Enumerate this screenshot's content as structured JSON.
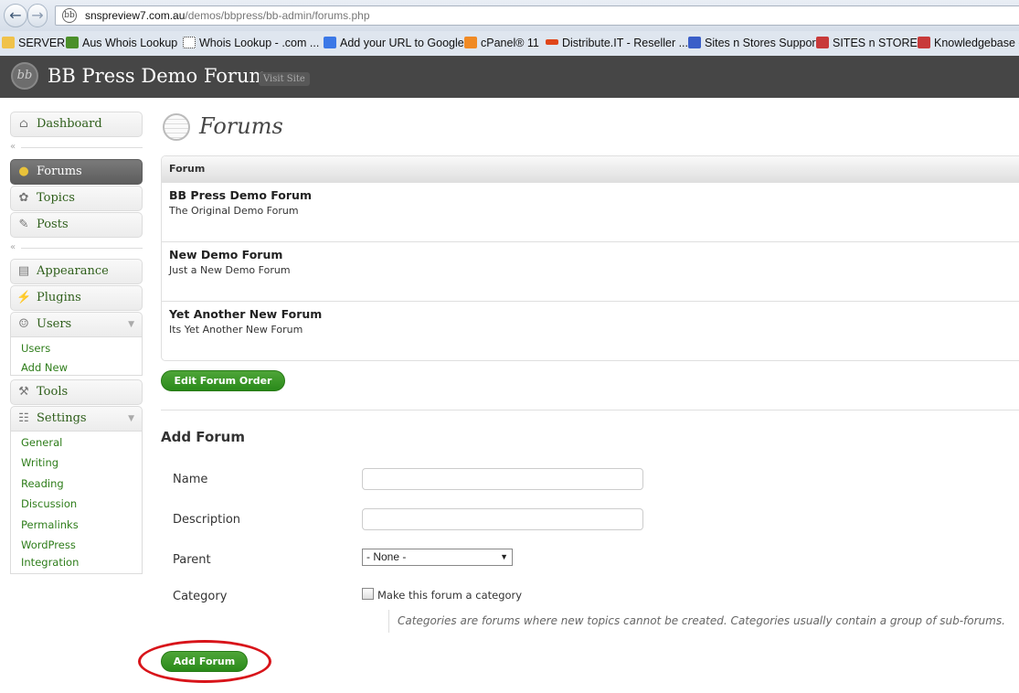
{
  "browser": {
    "url_domain": "snspreview7.com.au",
    "url_path": "/demos/bbpress/bb-admin/forums.php",
    "back_glyph": "←",
    "forward_glyph": "→",
    "bookmarks": [
      {
        "label": "SERVERS",
        "icon": "folder-icon",
        "color": "#f0c24a"
      },
      {
        "label": "Aus Whois Lookup",
        "icon": "aus-icon",
        "color": "#4a8f2a"
      },
      {
        "label": "Whois Lookup - .com ...",
        "icon": "page-icon",
        "color": "#ffffff"
      },
      {
        "label": "Add your URL to Google",
        "icon": "google-icon",
        "color": "#3b78e7"
      },
      {
        "label": "cPanel® 11",
        "icon": "cpanel-icon",
        "color": "#f08a24"
      },
      {
        "label": "Distribute.IT - Reseller ...",
        "icon": "distribute-icon",
        "color": "#e0461a"
      },
      {
        "label": "Sites n Stores Support",
        "icon": "sns-icon",
        "color": "#3a5ec8"
      },
      {
        "label": "SITES n STORES",
        "icon": "sns-icon",
        "color": "#c83a3a"
      },
      {
        "label": "Knowledgebase -",
        "icon": "sns-icon",
        "color": "#c83a3a"
      }
    ]
  },
  "header": {
    "logo_text": "bb",
    "site_title": "BB Press Demo Forum",
    "visit_site": "Visit Site"
  },
  "sidebar": {
    "dashboard": "Dashboard",
    "forums": "Forums",
    "topics": "Topics",
    "posts": "Posts",
    "appearance": "Appearance",
    "plugins": "Plugins",
    "users": "Users",
    "users_sub": [
      "Users",
      "Add New"
    ],
    "tools": "Tools",
    "settings": "Settings",
    "settings_sub": [
      "General",
      "Writing",
      "Reading",
      "Discussion",
      "Permalinks",
      "WordPress",
      "Integration"
    ]
  },
  "main": {
    "title": "Forums",
    "table_header": "Forum",
    "forums": [
      {
        "name": "BB Press Demo Forum",
        "description": "The Original Demo Forum"
      },
      {
        "name": "New Demo Forum",
        "description": "Just a New Demo Forum"
      },
      {
        "name": "Yet Another New Forum",
        "description": "Its Yet Another New Forum"
      }
    ],
    "edit_order_button": "Edit Forum Order"
  },
  "add_form": {
    "heading": "Add Forum",
    "name_label": "Name",
    "description_label": "Description",
    "parent_label": "Parent",
    "parent_value": "- None -",
    "category_label": "Category",
    "category_checkbox_label": "Make this forum a category",
    "category_note": "Categories are forums where new topics cannot be created. Categories usually contain a group of sub-forums.",
    "submit_button": "Add Forum"
  },
  "annotation": {
    "color": "#d8141a"
  }
}
